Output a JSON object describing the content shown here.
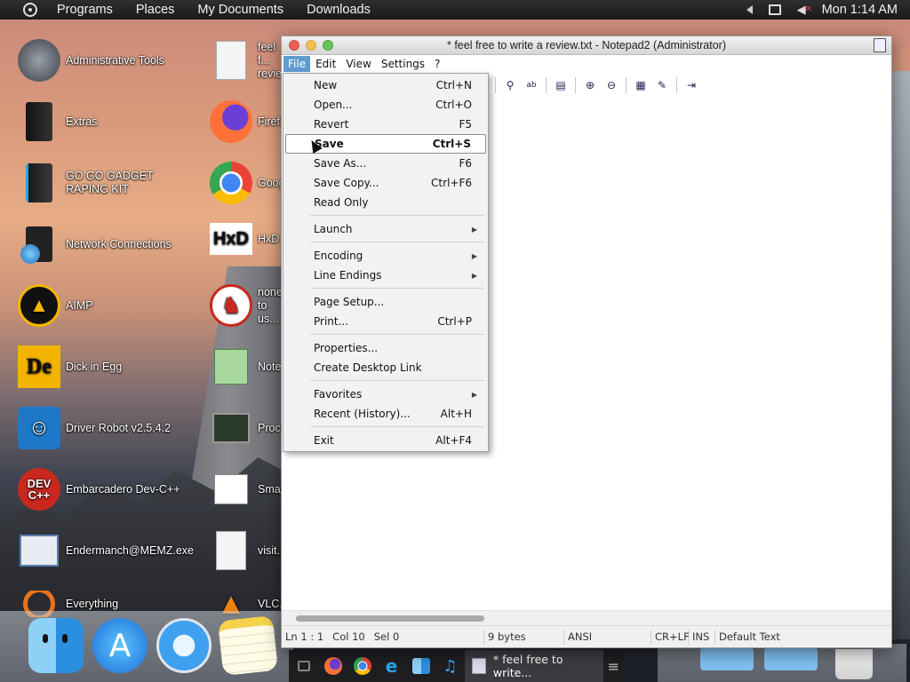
{
  "topbar": {
    "menus": [
      "Programs",
      "Places",
      "My Documents",
      "Downloads"
    ],
    "clock": "Mon 1:14 AM"
  },
  "desktop": {
    "icons_col1": [
      {
        "label": "Administrative Tools",
        "icon": "admin-tools-icon"
      },
      {
        "label": "Extras",
        "icon": "extras-icon"
      },
      {
        "label": "GO GO GADGET RAPING KIT",
        "icon": "pc-tower-icon"
      },
      {
        "label": "Network Connections",
        "icon": "network-icon"
      },
      {
        "label": "AIMP",
        "icon": "aimp-icon"
      },
      {
        "label": "Dick in Egg",
        "icon": "de-icon"
      },
      {
        "label": "Driver Robot v2.5.4.2",
        "icon": "robot-icon"
      },
      {
        "label": "Embarcadero Dev-C++",
        "icon": "devcpp-icon"
      },
      {
        "label": "Endermanch@MEMZ.exe",
        "icon": "exe-icon"
      },
      {
        "label": "Everything",
        "icon": "everything-icon"
      }
    ],
    "icons_col2": [
      {
        "label": "feel f... revie...",
        "icon": "text-file-icon"
      },
      {
        "label": "Firef...",
        "icon": "firefox-icon"
      },
      {
        "label": "Goog...",
        "icon": "chrome-icon"
      },
      {
        "label": "HxD",
        "icon": "hxd-icon"
      },
      {
        "label": "none to us...",
        "icon": "dino-icon"
      },
      {
        "label": "Note...",
        "icon": "notepad-icon"
      },
      {
        "label": "Proce...",
        "icon": "process-icon"
      },
      {
        "label": "Smar...",
        "icon": "smart-icon"
      },
      {
        "label": "visit...",
        "icon": "text-file-icon"
      },
      {
        "label": "VLC...",
        "icon": "vlc-icon"
      }
    ]
  },
  "window": {
    "title": "* feel free to write a review.txt - Notepad2 (Administrator)",
    "menus": [
      "File",
      "Edit",
      "View",
      "Settings",
      "?"
    ],
    "status": {
      "position": "Ln 1 : 1",
      "col": "Col 10",
      "sel": "Sel 0",
      "size": "9 bytes",
      "encoding": "ANSI",
      "line_endings": "CR+LF",
      "mode": "INS",
      "scheme": "Default Text"
    }
  },
  "file_menu": {
    "items": [
      {
        "label": "New",
        "shortcut": "Ctrl+N"
      },
      {
        "label": "Open...",
        "shortcut": "Ctrl+O"
      },
      {
        "label": "Revert",
        "shortcut": "F5"
      },
      {
        "label": "Save",
        "shortcut": "Ctrl+S"
      },
      {
        "label": "Save As...",
        "shortcut": "F6"
      },
      {
        "label": "Save Copy...",
        "shortcut": "Ctrl+F6"
      },
      {
        "label": "Read Only",
        "shortcut": ""
      },
      {
        "label": "Launch",
        "shortcut": ""
      },
      {
        "label": "Encoding",
        "shortcut": ""
      },
      {
        "label": "Line Endings",
        "shortcut": ""
      },
      {
        "label": "Page Setup...",
        "shortcut": ""
      },
      {
        "label": "Print...",
        "shortcut": "Ctrl+P"
      },
      {
        "label": "Properties...",
        "shortcut": ""
      },
      {
        "label": "Create Desktop Link",
        "shortcut": ""
      },
      {
        "label": "Favorites",
        "shortcut": ""
      },
      {
        "label": "Recent (History)...",
        "shortcut": "Alt+H"
      },
      {
        "label": "Exit",
        "shortcut": "Alt+F4"
      }
    ]
  },
  "taskbar": {
    "active_label": "* feel free to write..."
  },
  "colors": {
    "menu_highlight": "#5f9ccf",
    "close": "#ec5e55",
    "minimize": "#f4be4f",
    "maximize": "#63c556"
  }
}
